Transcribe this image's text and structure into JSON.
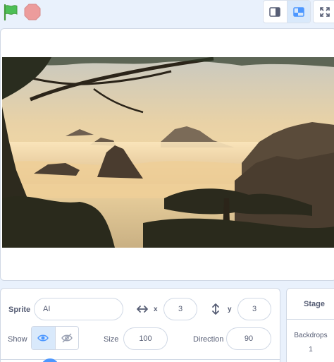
{
  "toolbar": {
    "flag_icon": "green-flag-icon",
    "stop_icon": "stop-sign-icon",
    "small_stage_icon": "small-stage-icon",
    "normal_stage_icon": "normal-stage-icon",
    "fullscreen_icon": "fullscreen-icon"
  },
  "stage": {
    "backdrop_description": "misty mountain landscape with pine trees"
  },
  "sprite": {
    "sprite_label": "Sprite",
    "sprite_name": "AI",
    "x_label": "x",
    "x_value": "3",
    "y_label": "y",
    "y_value": "3",
    "show_label": "Show",
    "size_label": "Size",
    "size_value": "100",
    "direction_label": "Direction",
    "direction_value": "90"
  },
  "stage_panel": {
    "title": "Stage",
    "backdrops_label": "Backdrops",
    "backdrops_count": "1"
  },
  "colors": {
    "accent": "#4c97ff",
    "flag": "#4cbf56",
    "stop": "#ec9c9c",
    "background": "#e9f1fc"
  }
}
